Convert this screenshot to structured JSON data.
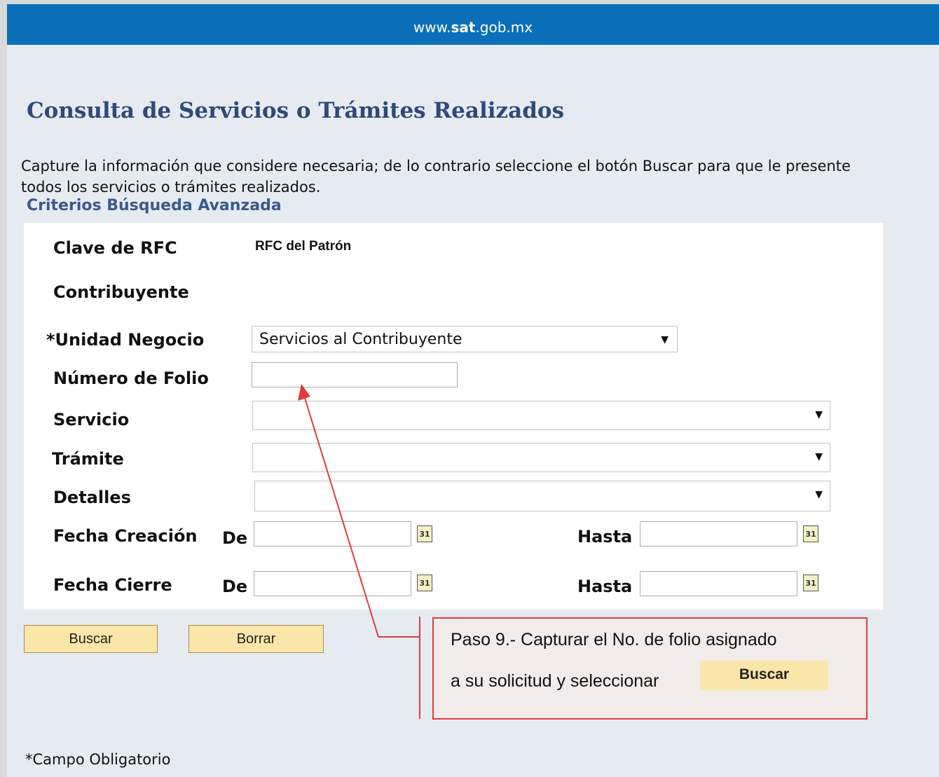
{
  "header": {
    "site_prefix": "www.",
    "site_bold": "sat",
    "site_suffix": ".gob.mx"
  },
  "page": {
    "title": "Consulta de Servicios o Trámites Realizados",
    "intro": "Capture la información que considere necesaria; de lo contrario seleccione el botón Buscar para que le presente todos los servicios o trámites realizados.",
    "subtitle": "Criterios Búsqueda Avanzada"
  },
  "form": {
    "rfc_label": "Clave de RFC",
    "rfc_value": "RFC del Patrón",
    "contribuyente_label": "Contribuyente",
    "unidad_label": "*Unidad Negocio",
    "unidad_value": "Servicios al Contribuyente",
    "folio_label": "Número de Folio",
    "folio_value": "",
    "servicio_label": "Servicio",
    "servicio_value": "",
    "tramite_label": "Trámite",
    "tramite_value": "",
    "detalles_label": "Detalles",
    "detalles_value": "",
    "fecha_creacion_label": "Fecha Creación",
    "fecha_cierre_label": "Fecha Cierre",
    "de_label": "De",
    "hasta_label": "Hasta",
    "calendar_glyph": "31"
  },
  "buttons": {
    "buscar": "Buscar",
    "borrar": "Borrar"
  },
  "callout": {
    "line1": "Paso 9.- Capturar el No. de folio asignado",
    "line2": "a su solicitud y seleccionar",
    "button": "Buscar",
    "border_color": "#e23b3b"
  },
  "footer": {
    "note": "*Campo Obligatorio"
  },
  "colors": {
    "topbar": "#0a6fb8",
    "title": "#2e4a7a",
    "button": "#fae6a9"
  },
  "icons": {
    "calendar": "calendar-icon",
    "dropdown": "chevron-down-icon"
  }
}
